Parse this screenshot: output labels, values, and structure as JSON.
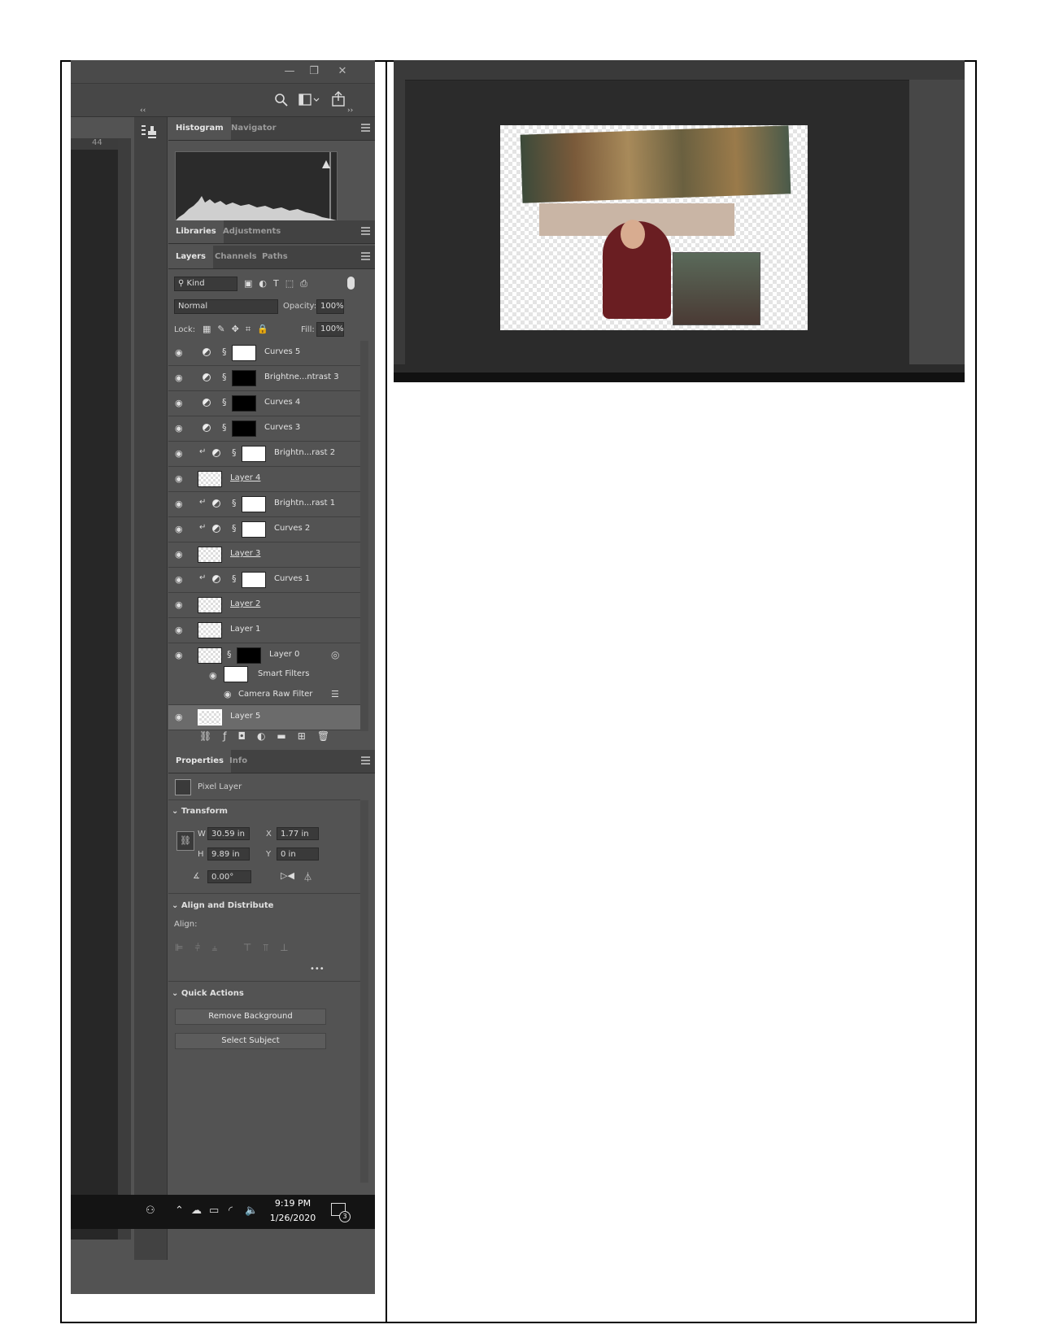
{
  "window": {
    "minimize": "—",
    "restore": "❐",
    "close": "✕"
  },
  "ruler": {
    "value": "44"
  },
  "panels": {
    "histogram_tabs": [
      "Histogram",
      "Navigator"
    ],
    "library_tabs": [
      "Libraries",
      "Adjustments"
    ],
    "layer_tabs": [
      "Layers",
      "Channels",
      "Paths"
    ],
    "properties_tabs": [
      "Properties",
      "Info"
    ]
  },
  "layers_panel": {
    "filter_kind": "Kind",
    "blend_mode": "Normal",
    "opacity_label": "Opacity:",
    "opacity_value": "100%",
    "lock_label": "Lock:",
    "fill_label": "Fill:",
    "fill_value": "100%"
  },
  "layers": [
    {
      "name": "Curves 5",
      "kind": "adjustment",
      "mask": "white",
      "clipped": false
    },
    {
      "name": "Brightne...ntrast 3",
      "kind": "adjustment",
      "mask": "black",
      "clipped": false
    },
    {
      "name": "Curves 4",
      "kind": "adjustment",
      "mask": "black",
      "clipped": false
    },
    {
      "name": "Curves 3",
      "kind": "adjustment",
      "mask": "black",
      "clipped": false
    },
    {
      "name": "Brightn...rast 2",
      "kind": "adjustment",
      "mask": "white",
      "clipped": true
    },
    {
      "name": "Layer 4",
      "kind": "pixel",
      "underline": true
    },
    {
      "name": "Brightn...rast 1",
      "kind": "adjustment",
      "mask": "white",
      "clipped": true
    },
    {
      "name": "Curves 2",
      "kind": "adjustment",
      "mask": "white",
      "clipped": true
    },
    {
      "name": "Layer 3",
      "kind": "pixel",
      "underline": true
    },
    {
      "name": "Curves 1",
      "kind": "adjustment",
      "mask": "white",
      "clipped": true
    },
    {
      "name": "Layer 2",
      "kind": "pixel",
      "underline": true
    },
    {
      "name": "Layer 1",
      "kind": "pixel",
      "underline": false
    },
    {
      "name": "Layer 0",
      "kind": "smart",
      "underline": false
    }
  ],
  "smart_filters": {
    "label": "Smart Filters",
    "filter": "Camera Raw Filter"
  },
  "bottom_layer": {
    "name": "Layer 5"
  },
  "properties": {
    "type": "Pixel Layer",
    "transform_label": "Transform",
    "w_label": "W",
    "w_value": "30.59 in",
    "h_label": "H",
    "h_value": "9.89 in",
    "x_label": "X",
    "x_value": "1.77 in",
    "y_label": "Y",
    "y_value": "0 in",
    "angle_value": "0.00°",
    "align_section": "Align and Distribute",
    "align_label": "Align:",
    "more": "•••",
    "quick_actions": "Quick Actions",
    "remove_bg": "Remove Background",
    "select_subject": "Select Subject"
  },
  "taskbar": {
    "time": "9:19 PM",
    "date": "1/26/2020",
    "notifications": "3"
  }
}
